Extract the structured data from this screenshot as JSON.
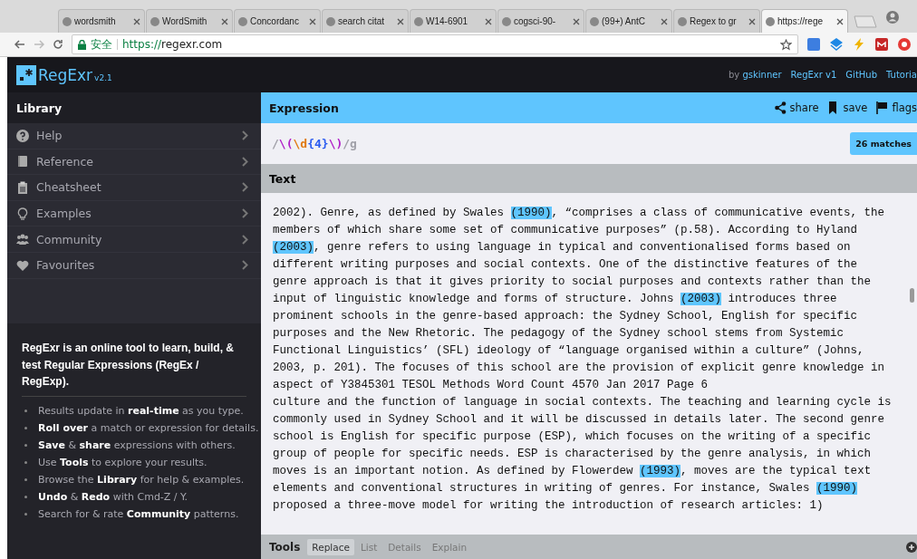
{
  "browser": {
    "tabs": [
      {
        "title": "wordsmith",
        "selected": false
      },
      {
        "title": "WordSmith",
        "selected": false
      },
      {
        "title": "Concordanc",
        "selected": false
      },
      {
        "title": "search citat",
        "selected": false
      },
      {
        "title": "W14-6901",
        "selected": false
      },
      {
        "title": "cogsci-90-",
        "selected": false
      },
      {
        "title": "(99+) AntC",
        "selected": false
      },
      {
        "title": "Regex to gr",
        "selected": false
      },
      {
        "title": "https://rege",
        "selected": true
      }
    ],
    "secure_label": "安全",
    "url_scheme": "https://",
    "url_host": "regexr.com"
  },
  "app": {
    "logo": "RegExr",
    "version": "v2.1",
    "nav": [
      {
        "label": "by ",
        "link": "gskinner"
      },
      {
        "label": "RegExr v1"
      },
      {
        "label": "GitHub"
      },
      {
        "label": "Tutoria"
      }
    ]
  },
  "library": {
    "title": "Library",
    "items": [
      {
        "label": "Help"
      },
      {
        "label": "Reference"
      },
      {
        "label": "Cheatsheet"
      },
      {
        "label": "Examples"
      },
      {
        "label": "Community"
      },
      {
        "label": "Favourites"
      }
    ],
    "intro": "RegExr is an online tool to learn, build, & test Regular Expressions (RegEx / RegExp).",
    "tips": [
      "Results update in **real-time** as you type.",
      "**Roll over** a match or expression for details.",
      "**Save** & **share** expressions with others.",
      "Use **Tools** to explore your results.",
      "Browse the **Library** for help & examples.",
      "**Undo** & **Redo** with Cmd-Z / Y.",
      "Search for & rate **Community** patterns."
    ]
  },
  "expression": {
    "title": "Expression",
    "actions": [
      {
        "label": "share"
      },
      {
        "label": "save"
      },
      {
        "label": "flags"
      }
    ],
    "tokens": [
      {
        "text": "/",
        "kind": "delim"
      },
      {
        "text": "\\(",
        "kind": "escape"
      },
      {
        "text": "\\d",
        "kind": "class"
      },
      {
        "text": "{4}",
        "kind": "quant"
      },
      {
        "text": "\\)",
        "kind": "escape"
      },
      {
        "text": "/g",
        "kind": "delim"
      }
    ],
    "matches": "26 matches"
  },
  "text": {
    "title": "Text",
    "lines": [
      [
        {
          "t": "2002). Genre, as defined by Swales ",
          "m": false
        },
        {
          "t": "(1990)",
          "m": true
        },
        {
          "t": ", “comprises a class of communicative events, the",
          "m": false
        }
      ],
      [
        {
          "t": "members of which share some set of communicative purposes” (p.58). According to Hyland",
          "m": false
        }
      ],
      [
        {
          "t": "(2003)",
          "m": true
        },
        {
          "t": ", genre refers to using language in typical and conventionalised forms based on",
          "m": false
        }
      ],
      [
        {
          "t": "different writing purposes and social contexts. One of the distinctive features of the",
          "m": false
        }
      ],
      [
        {
          "t": "genre approach is that it gives priority to social purposes and contexts rather than the",
          "m": false
        }
      ],
      [
        {
          "t": "input of linguistic knowledge and forms of structure. Johns ",
          "m": false
        },
        {
          "t": "(2003)",
          "m": true
        },
        {
          "t": " introduces three",
          "m": false
        }
      ],
      [
        {
          "t": "prominent schools in the genre-based approach: the Sydney School, English for specific",
          "m": false
        }
      ],
      [
        {
          "t": "purposes and the New Rhetoric. The pedagogy of the Sydney school stems from Systemic",
          "m": false
        }
      ],
      [
        {
          "t": "Functional Linguistics’ (SFL) ideology of “language organised within a culture” (Johns,",
          "m": false
        }
      ],
      [
        {
          "t": "2003, p. 201). The focuses of this school are the provision of explicit genre knowledge in",
          "m": false
        }
      ],
      [
        {
          "t": "aspect of Y3845301 TESOL Methods Word Count 4570 Jan 2017 Page 6",
          "m": false
        }
      ],
      [
        {
          "t": "culture and the function of language in social contexts. The teaching and learning cycle is",
          "m": false
        }
      ],
      [
        {
          "t": "commonly used in Sydney School and it will be discussed in details later. The second genre",
          "m": false
        }
      ],
      [
        {
          "t": "school is English for specific purpose (ESP), which focuses on the writing of a specific",
          "m": false
        }
      ],
      [
        {
          "t": "group of people for specific needs. ESP is characterised by the genre analysis, in which",
          "m": false
        }
      ],
      [
        {
          "t": "moves is an important notion. As defined by Flowerdew ",
          "m": false
        },
        {
          "t": "(1993)",
          "m": true
        },
        {
          "t": ", moves are the typical text",
          "m": false
        }
      ],
      [
        {
          "t": "elements and conventional structures in writing of genres. For instance, Swales ",
          "m": false
        },
        {
          "t": "(1990)",
          "m": true
        }
      ],
      [
        {
          "t": "proposed a three-move model for writing the introduction of research articles: 1)",
          "m": false
        }
      ]
    ]
  },
  "tools": {
    "title": "Tools",
    "tabs": [
      {
        "label": "Replace",
        "selected": true
      },
      {
        "label": "List",
        "selected": false
      },
      {
        "label": "Details",
        "selected": false
      },
      {
        "label": "Explain",
        "selected": false
      }
    ]
  }
}
